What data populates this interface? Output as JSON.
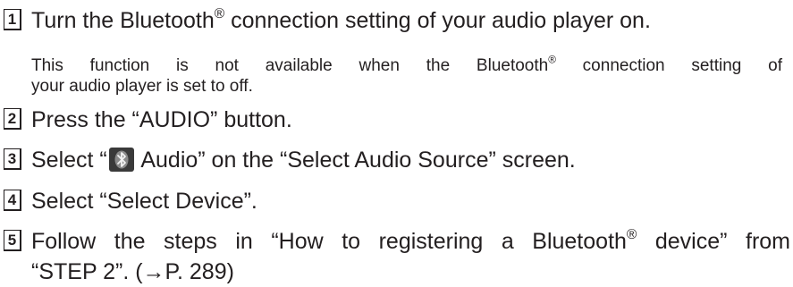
{
  "steps": [
    {
      "num": "1",
      "pre": "Turn the Bluetooth",
      "reg": "®",
      "post": " connection setting of your audio player on."
    },
    {
      "num": "2",
      "text": "Press the “AUDIO” button."
    },
    {
      "num": "3",
      "pre": "Select “",
      "icon": "bluetooth-audio-icon",
      "post": " Audio” on the “Select Audio Source” screen."
    },
    {
      "num": "4",
      "text": "Select “Select Device”."
    },
    {
      "num": "5",
      "line1_pre": "Follow the steps in “How to registering a Bluetooth",
      "reg": "®",
      "line1_post": " device” from",
      "line2": "“STEP 2”. (→P. 289)"
    }
  ],
  "note": {
    "line1_pre": "This function is not available when the Bluetooth",
    "reg": "®",
    "line1_post": " connection setting of",
    "line2": "your audio player is set to off."
  },
  "colors": {
    "text": "#231f20",
    "icon_bg": "#3a3a3a",
    "icon_fg": "#f2f2f2"
  }
}
